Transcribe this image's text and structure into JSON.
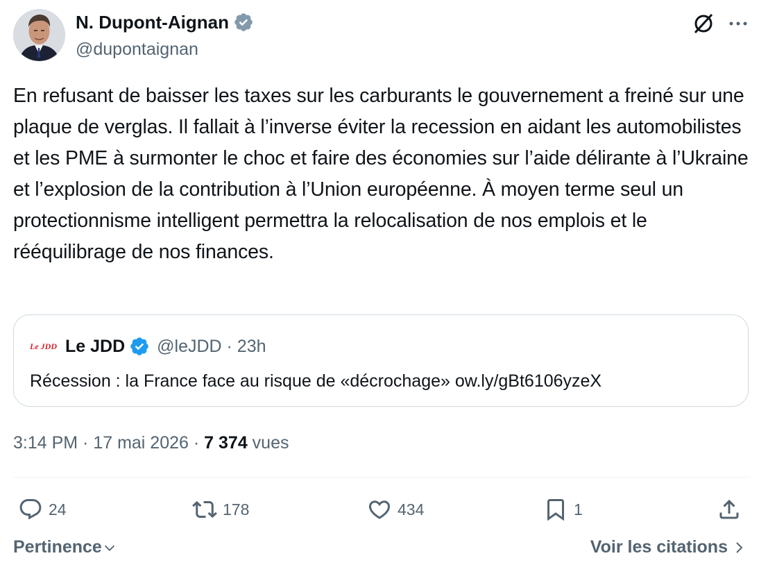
{
  "author": {
    "name": "N. Dupont-Aignan",
    "handle": "@dupontaignan",
    "verified": true
  },
  "tweet": {
    "text": "En refusant de baisser les taxes sur les carburants le gouvernement a freiné sur une plaque de verglas. Il fallait à l’inverse éviter la recession en aidant les automobilistes et les PME à surmonter le choc et faire des économies sur l’aide délirante à l’Ukraine et l’explosion de la contribution à l’Union européenne. À moyen terme seul un protectionnisme intelligent permettra la relocalisation de nos emplois et le rééquilibrage de nos finances."
  },
  "quote": {
    "logo_text": "Le JDD",
    "name": "Le JDD",
    "handle_time": "@leJDD · 23h",
    "text": "Récession : la France face au risque de «décrochage» ow.ly/gBt6106yzeX"
  },
  "meta": {
    "time": "3:14 PM",
    "sep1": " · ",
    "date": "17 mai 2026",
    "sep2": " · ",
    "views_count": "7 374",
    "views_label": "vues"
  },
  "actions": {
    "replies": "24",
    "retweets": "178",
    "likes": "434",
    "bookmarks": "1"
  },
  "footer": {
    "sort_label": "Pertinence",
    "citations_label": "Voir les citations"
  },
  "colors": {
    "text": "#0f1419",
    "secondary": "#536471",
    "verified": "#1d9bf0",
    "border": "#cfd9de",
    "jdd_red": "#d8202a"
  },
  "icons": [
    "verified-badge-icon",
    "grok-icon",
    "more-icon",
    "reply-icon",
    "retweet-icon",
    "like-icon",
    "bookmark-icon",
    "share-icon",
    "chevron-down-icon",
    "chevron-right-icon"
  ]
}
